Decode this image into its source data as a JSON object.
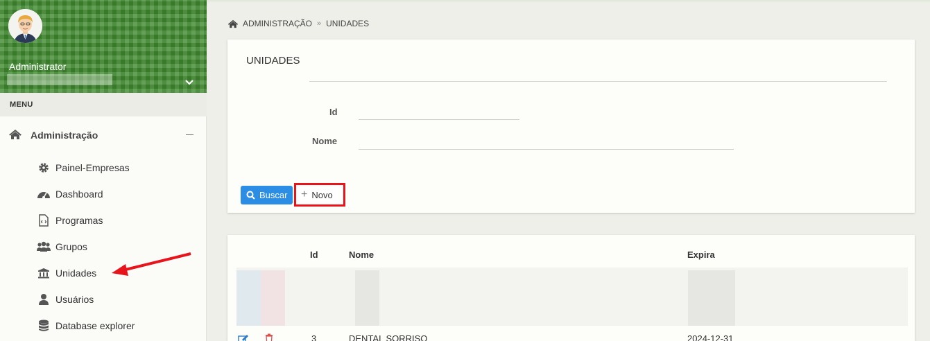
{
  "sidebar": {
    "user_name": "Administrator",
    "menu_label": "MENU",
    "group_label": "Administração",
    "items": [
      {
        "label": "Painel-Empresas",
        "icon": "gear-icon"
      },
      {
        "label": "Dashboard",
        "icon": "dashboard-icon"
      },
      {
        "label": "Programas",
        "icon": "file-code-icon"
      },
      {
        "label": "Grupos",
        "icon": "users-icon"
      },
      {
        "label": "Unidades",
        "icon": "bank-icon"
      },
      {
        "label": "Usuários",
        "icon": "user-icon"
      },
      {
        "label": "Database explorer",
        "icon": "database-icon"
      }
    ]
  },
  "breadcrumb": {
    "items": [
      "ADMINISTRAÇÃO",
      "UNIDADES"
    ]
  },
  "form": {
    "title": "UNIDADES",
    "id_label": "Id",
    "nome_label": "Nome",
    "id_value": "",
    "nome_value": "",
    "buscar_label": "Buscar",
    "novo_label": "Novo"
  },
  "table": {
    "headers": {
      "id": "Id",
      "nome": "Nome",
      "expira": "Expira"
    },
    "rows": [
      {
        "id": "3",
        "nome": "DENTAL SORRISO",
        "expira": "2024-12-31"
      }
    ]
  },
  "colors": {
    "header_green": "#3f8a2f",
    "primary_blue": "#2c8de4",
    "annotation_red": "#e8141c"
  }
}
